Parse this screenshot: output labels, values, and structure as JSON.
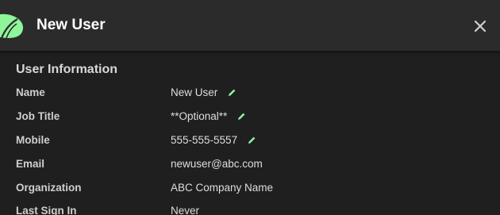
{
  "header": {
    "title": "New User",
    "logo_icon": "green-leaf-logo-icon",
    "close_icon": "close-icon"
  },
  "section": {
    "title": "User Information"
  },
  "fields": [
    {
      "label": "Name",
      "value": "New User",
      "editable": true
    },
    {
      "label": "Job Title",
      "value": "**Optional**",
      "editable": true
    },
    {
      "label": "Mobile",
      "value": "555-555-5557",
      "editable": true
    },
    {
      "label": "Email",
      "value": "newuser@abc.com",
      "editable": false
    },
    {
      "label": "Organization",
      "value": "ABC Company Name",
      "editable": false
    },
    {
      "label": "Last Sign In",
      "value": "Never",
      "editable": false
    }
  ],
  "colors": {
    "accent": "#8ef59a",
    "header_bg": "#2b2b2b",
    "body_bg": "#1f1f1f"
  }
}
